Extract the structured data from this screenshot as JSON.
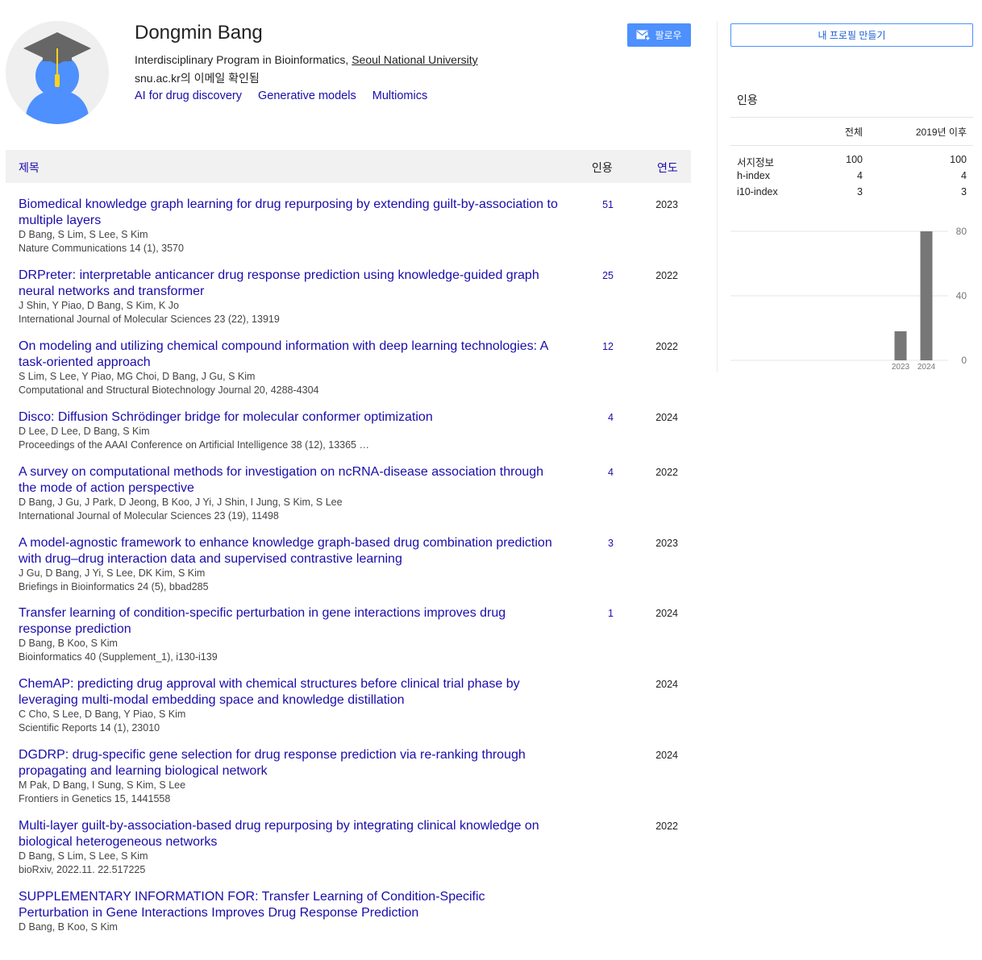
{
  "profile": {
    "name": "Dongmin Bang",
    "affiliation_prefix": "Interdisciplinary Program in Bioinformatics, ",
    "affiliation_org": "Seoul National University",
    "email": "snu.ac.kr의 이메일 확인됨",
    "interests": [
      "AI for drug discovery",
      "Generative models",
      "Multiomics"
    ],
    "follow_label": "팔로우",
    "follow_icon": "mail-plus-icon",
    "avatar_icon": "graduate-avatar-icon"
  },
  "table": {
    "col_title": "제목",
    "col_cited": "인용",
    "col_year": "연도"
  },
  "articles": [
    {
      "title": "Biomedical knowledge graph learning for drug repurposing by extending guilt-by-association to multiple layers",
      "authors": "D Bang, S Lim, S Lee, S Kim",
      "venue": "Nature Communications 14 (1), 3570",
      "cited": "51",
      "year": "2023"
    },
    {
      "title": "DRPreter: interpretable anticancer drug response prediction using knowledge-guided graph neural networks and transformer",
      "authors": "J Shin, Y Piao, D Bang, S Kim, K Jo",
      "venue": "International Journal of Molecular Sciences 23 (22), 13919",
      "cited": "25",
      "year": "2022"
    },
    {
      "title": "On modeling and utilizing chemical compound information with deep learning technologies: A task-oriented approach",
      "authors": "S Lim, S Lee, Y Piao, MG Choi, D Bang, J Gu, S Kim",
      "venue": "Computational and Structural Biotechnology Journal 20, 4288-4304",
      "cited": "12",
      "year": "2022"
    },
    {
      "title": "Disco: Diffusion Schrödinger bridge for molecular conformer optimization",
      "authors": "D Lee, D Lee, D Bang, S Kim",
      "venue": "Proceedings of the AAAI Conference on Artificial Intelligence 38 (12), 13365 …",
      "cited": "4",
      "year": "2024",
      "short": true
    },
    {
      "title": "A survey on computational methods for investigation on ncRNA-disease association through the mode of action perspective",
      "authors": "D Bang, J Gu, J Park, D Jeong, B Koo, J Yi, J Shin, I Jung, S Kim, S Lee",
      "venue": "International Journal of Molecular Sciences 23 (19), 11498",
      "cited": "4",
      "year": "2022"
    },
    {
      "title": "A model-agnostic framework to enhance knowledge graph-based drug combination prediction with drug–drug interaction data and supervised contrastive learning",
      "authors": "J Gu, D Bang, J Yi, S Lee, DK Kim, S Kim",
      "venue": "Briefings in Bioinformatics 24 (5), bbad285",
      "cited": "3",
      "year": "2023"
    },
    {
      "title": "Transfer learning of condition-specific perturbation in gene interactions improves drug response prediction",
      "authors": "D Bang, B Koo, S Kim",
      "venue": "Bioinformatics 40 (Supplement_1), i130-i139",
      "cited": "1",
      "year": "2024"
    },
    {
      "title": "ChemAP: predicting drug approval with chemical structures before clinical trial phase by leveraging multi-modal embedding space and knowledge distillation",
      "authors": "C Cho, S Lee, D Bang, Y Piao, S Kim",
      "venue": "Scientific Reports 14 (1), 23010",
      "cited": "",
      "year": "2024"
    },
    {
      "title": "DGDRP: drug-specific gene selection for drug response prediction via re-ranking through propagating and learning biological network",
      "authors": "M Pak, D Bang, I Sung, S Kim, S Lee",
      "venue": "Frontiers in Genetics 15, 1441558",
      "cited": "",
      "year": "2024"
    },
    {
      "title": "Multi-layer guilt-by-association-based drug repurposing by integrating clinical knowledge on biological heterogeneous networks",
      "authors": "D Bang, S Lim, S Lee, S Kim",
      "venue": "bioRxiv, 2022.11. 22.517225",
      "cited": "",
      "year": "2022"
    },
    {
      "title": "SUPPLEMENTARY INFORMATION FOR: Transfer Learning of Condition-Specific Perturbation in Gene Interactions Improves Drug Response Prediction",
      "authors": "D Bang, B Koo, S Kim",
      "venue": "",
      "cited": "",
      "year": ""
    }
  ],
  "sidebar": {
    "create_profile_label": "내 프로필 만들기",
    "cited_by_label": "인용",
    "stats_header": {
      "all": "전체",
      "since": "2019년 이후"
    },
    "stats": [
      {
        "label": "서지정보",
        "all": "100",
        "since": "100"
      },
      {
        "label": "h-index",
        "all": "4",
        "since": "4"
      },
      {
        "label": "i10-index",
        "all": "3",
        "since": "3"
      }
    ]
  },
  "chart_data": {
    "type": "bar",
    "categories": [
      "2023",
      "2024"
    ],
    "values": [
      18,
      80
    ],
    "ylim": [
      0,
      80
    ],
    "yticks": [
      "0",
      "40",
      "80"
    ],
    "grid": true,
    "bar_color": "#777777"
  }
}
